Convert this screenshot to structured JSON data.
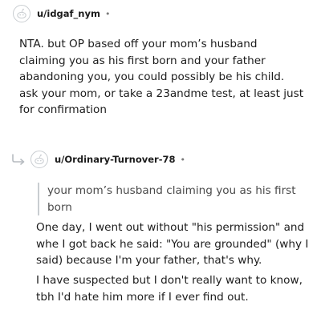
{
  "comment1": {
    "username": "u/idgaf_nym",
    "separator": "•",
    "avatar_icon": "reddit-snoo-icon",
    "text": "NTA. but OP based off your mom’s husband claiming you as his first born and your father abandoning you, you could possibly be his child. ask your mom, or take a 23andme test, at least just for confirmation"
  },
  "comment2": {
    "username": "u/Ordinary-Turnover-78",
    "separator": "•",
    "avatar_icon": "reddit-snoo-icon",
    "reply_icon": "reply-arrow-icon",
    "quote": "your mom’s husband claiming you as his first born",
    "paragraph1": "One day, I went out without \"his permission\" and whe I got back he said: \"You are grounded\" (why I said) because I'm your father, that's why.",
    "paragraph2": "I have suspected but I don't really want to know, tbh I'd hate him more if I ever find out."
  },
  "colors": {
    "text": "#1c1c1c",
    "muted": "#7c7c7c",
    "quote_text": "#4a4a4a",
    "border": "#c9cdd1"
  }
}
